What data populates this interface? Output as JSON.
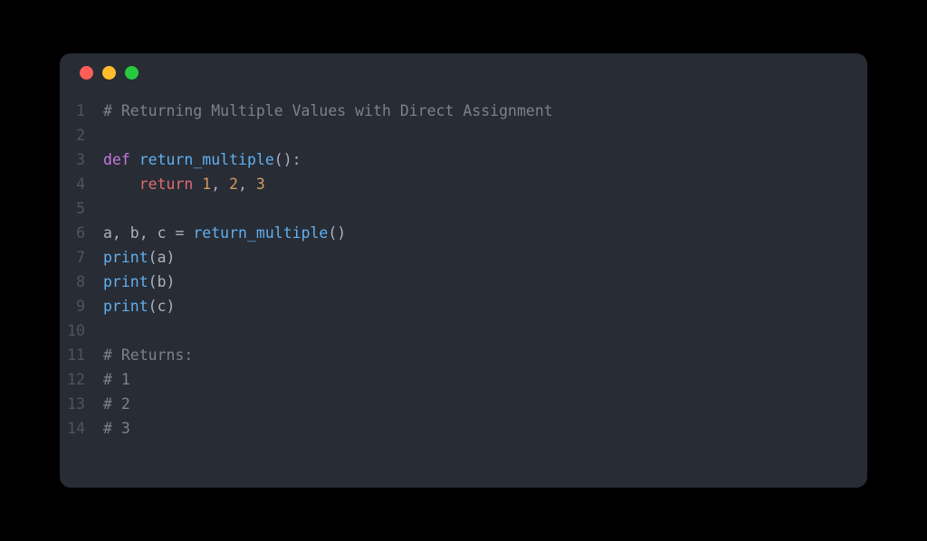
{
  "editor": {
    "window_controls": {
      "close": "close",
      "minimize": "minimize",
      "zoom": "zoom"
    },
    "lines": [
      {
        "num": "1",
        "tokens": [
          {
            "cls": "tok-comment",
            "text": "# Returning Multiple Values with Direct Assignment"
          }
        ]
      },
      {
        "num": "2",
        "tokens": []
      },
      {
        "num": "3",
        "tokens": [
          {
            "cls": "tok-keyword",
            "text": "def"
          },
          {
            "cls": "tok-punct",
            "text": " "
          },
          {
            "cls": "tok-funcdef",
            "text": "return_multiple"
          },
          {
            "cls": "tok-punct",
            "text": "():"
          }
        ]
      },
      {
        "num": "4",
        "tokens": [
          {
            "cls": "tok-punct",
            "text": "    "
          },
          {
            "cls": "tok-return",
            "text": "return"
          },
          {
            "cls": "tok-punct",
            "text": " "
          },
          {
            "cls": "tok-number",
            "text": "1"
          },
          {
            "cls": "tok-punct",
            "text": ", "
          },
          {
            "cls": "tok-number",
            "text": "2"
          },
          {
            "cls": "tok-punct",
            "text": ", "
          },
          {
            "cls": "tok-number",
            "text": "3"
          }
        ]
      },
      {
        "num": "5",
        "tokens": []
      },
      {
        "num": "6",
        "tokens": [
          {
            "cls": "tok-ident",
            "text": "a, b, c "
          },
          {
            "cls": "tok-punct",
            "text": "= "
          },
          {
            "cls": "tok-funcname",
            "text": "return_multiple"
          },
          {
            "cls": "tok-punct",
            "text": "()"
          }
        ]
      },
      {
        "num": "7",
        "tokens": [
          {
            "cls": "tok-funcname",
            "text": "print"
          },
          {
            "cls": "tok-punct",
            "text": "(a)"
          }
        ]
      },
      {
        "num": "8",
        "tokens": [
          {
            "cls": "tok-funcname",
            "text": "print"
          },
          {
            "cls": "tok-punct",
            "text": "(b)"
          }
        ]
      },
      {
        "num": "9",
        "tokens": [
          {
            "cls": "tok-funcname",
            "text": "print"
          },
          {
            "cls": "tok-punct",
            "text": "(c)"
          }
        ]
      },
      {
        "num": "10",
        "tokens": []
      },
      {
        "num": "11",
        "tokens": [
          {
            "cls": "tok-comment",
            "text": "# Returns:"
          }
        ]
      },
      {
        "num": "12",
        "tokens": [
          {
            "cls": "tok-comment",
            "text": "# 1"
          }
        ]
      },
      {
        "num": "13",
        "tokens": [
          {
            "cls": "tok-comment",
            "text": "# 2"
          }
        ]
      },
      {
        "num": "14",
        "tokens": [
          {
            "cls": "tok-comment",
            "text": "# 3"
          }
        ]
      }
    ]
  }
}
